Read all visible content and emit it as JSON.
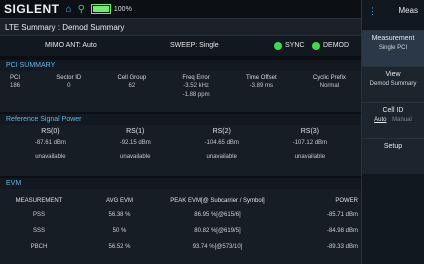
{
  "topbar": {
    "brand": "SIGLENT",
    "icons": [
      "home-icon",
      "usb-icon",
      "battery-icon"
    ],
    "battery_text": "100%",
    "battery_level_percent": 100
  },
  "titlebar": {
    "title": "LTE Summary : Demod Summary"
  },
  "status": {
    "mimo": "MIMO ANT: Auto",
    "sweep": "SWEEP: Single",
    "sync_label": "SYNC",
    "demod_label": "DEMOD",
    "led_color": "#3ddc4c"
  },
  "pci_summary": {
    "header": "PCI SUMMARY",
    "columns": [
      {
        "label": "PCI",
        "value": "186",
        "value2": ""
      },
      {
        "label": "Sector ID",
        "value": "0",
        "value2": ""
      },
      {
        "label": "Cell Group",
        "value": "62",
        "value2": ""
      },
      {
        "label": "Freq Error",
        "value": "-3.52 kHz",
        "value2": "-1.88 ppm"
      },
      {
        "label": "Time Offset",
        "value": "-3.89 ms",
        "value2": ""
      },
      {
        "label": "Cyclic Prefix",
        "value": "Normal",
        "value2": ""
      }
    ]
  },
  "ref_signal": {
    "header": "Reference Signal Power",
    "columns": [
      {
        "label": "RS(0)",
        "power": "-87.61 dBm",
        "status": "unavailable"
      },
      {
        "label": "RS(1)",
        "power": "-92.15 dBm",
        "status": "unavailable"
      },
      {
        "label": "RS(2)",
        "power": "-104.65 dBm",
        "status": "unavailable"
      },
      {
        "label": "RS(3)",
        "power": "-107.12 dBm",
        "status": "unavailable"
      }
    ]
  },
  "evm": {
    "header": "EVM",
    "columns": [
      "MEASUREMENT",
      "AVG EVM",
      "PEAK EVM[@ Subcarrier / Symbol]",
      "POWER"
    ],
    "rows": [
      {
        "name": "PSS",
        "avg": "56.38 %",
        "peak": "86.95 %[@615/6]",
        "power": "-85.71 dBm"
      },
      {
        "name": "SSS",
        "avg": "50 %",
        "peak": "80.82 %[@619/5]",
        "power": "-84.98 dBm"
      },
      {
        "name": "PBCH",
        "avg": "56.52 %",
        "peak": "93.74 %[@573/10]",
        "power": "-89.33 dBm"
      }
    ]
  },
  "softkeys": {
    "title": "Meas",
    "menu_icon": "menu-icon",
    "items": [
      {
        "line1": "Measurement",
        "line2": "Single PCI"
      },
      {
        "line1": "View",
        "line2": "Demod Summary"
      },
      {
        "line1": "Cell ID",
        "choice_on": "Auto",
        "choice_off": "Manual"
      },
      {
        "line1": "Setup"
      }
    ]
  }
}
